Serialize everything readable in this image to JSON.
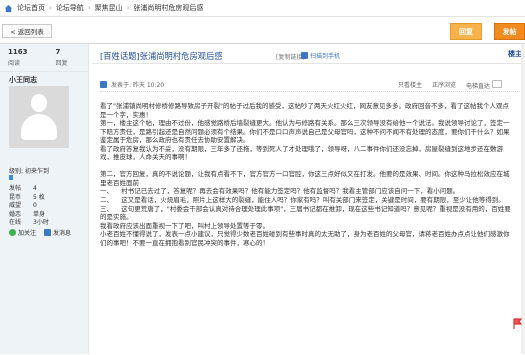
{
  "breadcrumb": {
    "items": [
      "论坛首页",
      "论坛导航",
      "聚焦昆山",
      "张浦尚明村危房观后感"
    ]
  },
  "back_label": "< 返回列表",
  "reply_label": "回复",
  "post_label": "发帖",
  "stats": {
    "views": "1163",
    "views_label": "阅读",
    "replies": "7",
    "replies_label": "回复"
  },
  "author": {
    "name": "小王同志",
    "rank_label": "级别:",
    "rank": "初来乍到",
    "info": [
      {
        "k": "发帖",
        "v": "4"
      },
      {
        "k": "昆币",
        "v": "5 枚"
      },
      {
        "k": "威望",
        "v": "0"
      },
      {
        "k": "婚恋",
        "v": "单身"
      },
      {
        "k": "在线",
        "v": "3小时"
      }
    ],
    "add_friend": "加关注",
    "message": "发消息"
  },
  "post": {
    "title": "[百姓话题]张浦尚明村危房观后感",
    "copy_link": "[复制链接]",
    "scan_label": "扫描到手机",
    "floor_label": "楼主",
    "floor_prefix": "1",
    "posted": "发表于: 昨天 10:20",
    "view_only": "只看楼主",
    "font_label": "正序浏览",
    "mode_label": "电梯直达",
    "paragraphs": [
      "看了\"张浦镇尚明村修桥修路导致房子开裂\"的帖子过后我的感受，这帖吵了两天火红火红，网友意见多多。政府回音不多，看了这帖我个人观点是一个字，实惠！",
      "第一，楼主这个帖，理由不过份，他感觉路桥后墙裂缝更大。他认为与修路有关系。那么三次领导没有给他一个说法。我说领导讨论了，签定一下赔方责任，是路引起还是自然问题必须有个结果。你们不是口口声声说自己是父母官吗，这种不问不闻不有处理的态度，要你们干什么？如果鉴定属于危房，那么政府也有责任去协助安置解决。",
      "看了政府答复我认为不妥，没有期限，三年多了还拖，等到死人了才处理哦了，领导呀，八二事件你们还没忘掉，房屋裂缝到这地步还在敷游戏，推皮球，人命关天的事啊！",
      "",
      "第二，官方回复，真的不说论题，让我有点看不下，官方官方一口官腔，你这三点好似又在打发。他要的是效果、时间。你这种马拉松效应在城里老百姓面前",
      "一、    村书记已去过了，答复呢？再去会有效果吗？他有能力签定吗？他有监督吗？我看主管部门应该自问一下，看小问题。",
      "二、    这又是看话，火烧眉毛，照片上这样大的裂缝，能住人吗？你家有吗？叫有关部门来签定，关键是时间，要有期限，至少让他等得到。",
      "三、    这句更荒唐了，\"村委会干部会认真对待合理处理此事项\"，三届书记都在推卸，现在这些书记知道吗？意见呢？重视是没有用的，百姓要的是实施。",
      "我看政府应该出面重视一下了吧，叫村上领导处置等于零。",
      "小老百姓不懂得说了，发表一点小建议，只觉得少数老百姓碰到有些事时真的太无助了，身为老百姓的父母官，请蒋老百姓办点点让他们感激你们的事吧！不要一直在拥抱看别官民冲突的事件，寒心的！"
    ]
  },
  "colors": {
    "title": "#1d4d9a",
    "sidebar_bg": "#eef3f7",
    "reply_btn": "#f6b24b",
    "post_btn": "#f28b1f"
  }
}
